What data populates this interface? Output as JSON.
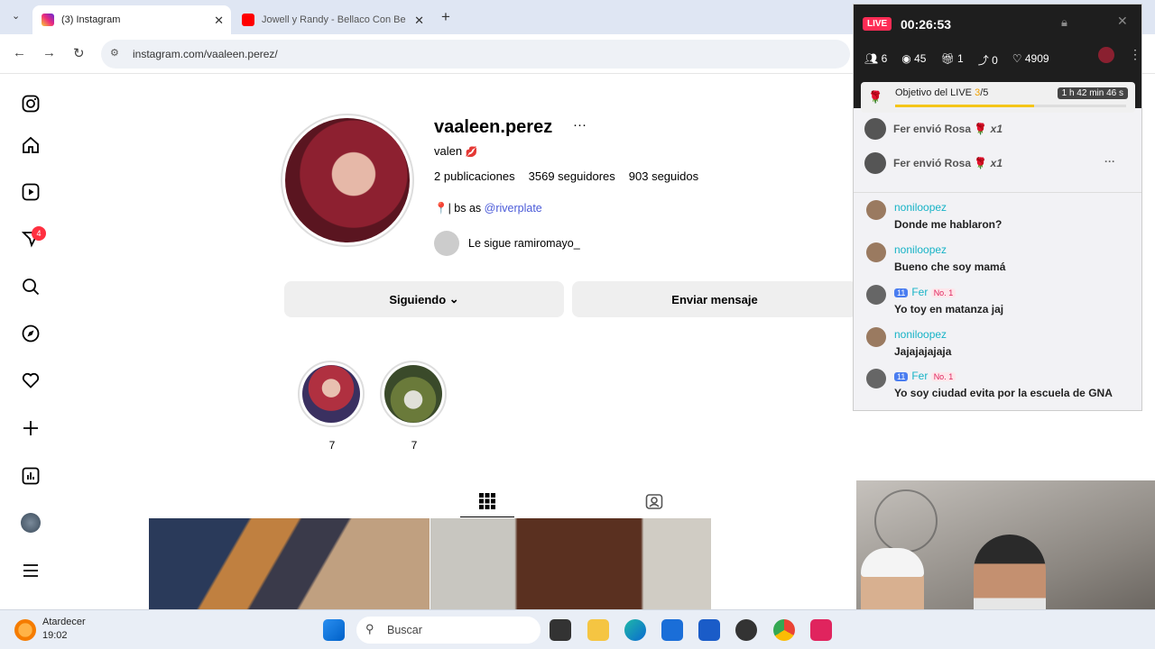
{
  "browser": {
    "tabs": [
      {
        "label": "(3) Instagram"
      },
      {
        "label": "Jowell y Randy - Bellaco Con Be"
      }
    ],
    "url": "instagram.com/vaaleen.perez/"
  },
  "profile": {
    "username": "vaaleen.perez",
    "name": "valen",
    "posts": "2 publicaciones",
    "followers": "3569 seguidores",
    "following": "903 seguidos",
    "bio_prefix": "📍| bs as",
    "bio_link": "@riverplate",
    "followed_by_prefix": "Le sigue",
    "followed_by": "ramiromayo_",
    "following_button": "Siguiendo",
    "message_button": "Enviar mensaje",
    "highlights": [
      {
        "count": "7"
      },
      {
        "count": "7"
      }
    ],
    "notification_count": "4"
  },
  "live": {
    "badge": "LIVE",
    "timer": "00:26:53",
    "stats": {
      "users": "6",
      "views": "45",
      "gifts": "1",
      "shares": "0",
      "likes": "4909"
    },
    "goal_label": "Objetivo del LIVE",
    "goal_progress": "3",
    "goal_total": "/5",
    "goal_fraction": 0.6,
    "goal_time": "1 h 42 min 46 s",
    "gifts": [
      {
        "text": "Fer envió Rosa",
        "mult": "x1"
      },
      {
        "text": "Fer envió Rosa",
        "mult": "x1"
      }
    ],
    "chat": [
      {
        "user": "noniloopez",
        "msg": "Donde me hablaron?"
      },
      {
        "user": "noniloopez",
        "msg": "Bueno che soy mamá"
      },
      {
        "level": "11",
        "user": "Fer",
        "rank": "No. 1",
        "msg": "Yo toy en matanza jaj"
      },
      {
        "user": "noniloopez",
        "msg": "Jajajajajaja"
      },
      {
        "level": "11",
        "user": "Fer",
        "rank": "No. 1",
        "msg": "Yo soy ciudad evita por la escuela de GNA"
      }
    ]
  },
  "taskbar": {
    "weather": "Atardecer",
    "time": "19:02",
    "search_placeholder": "Buscar"
  }
}
